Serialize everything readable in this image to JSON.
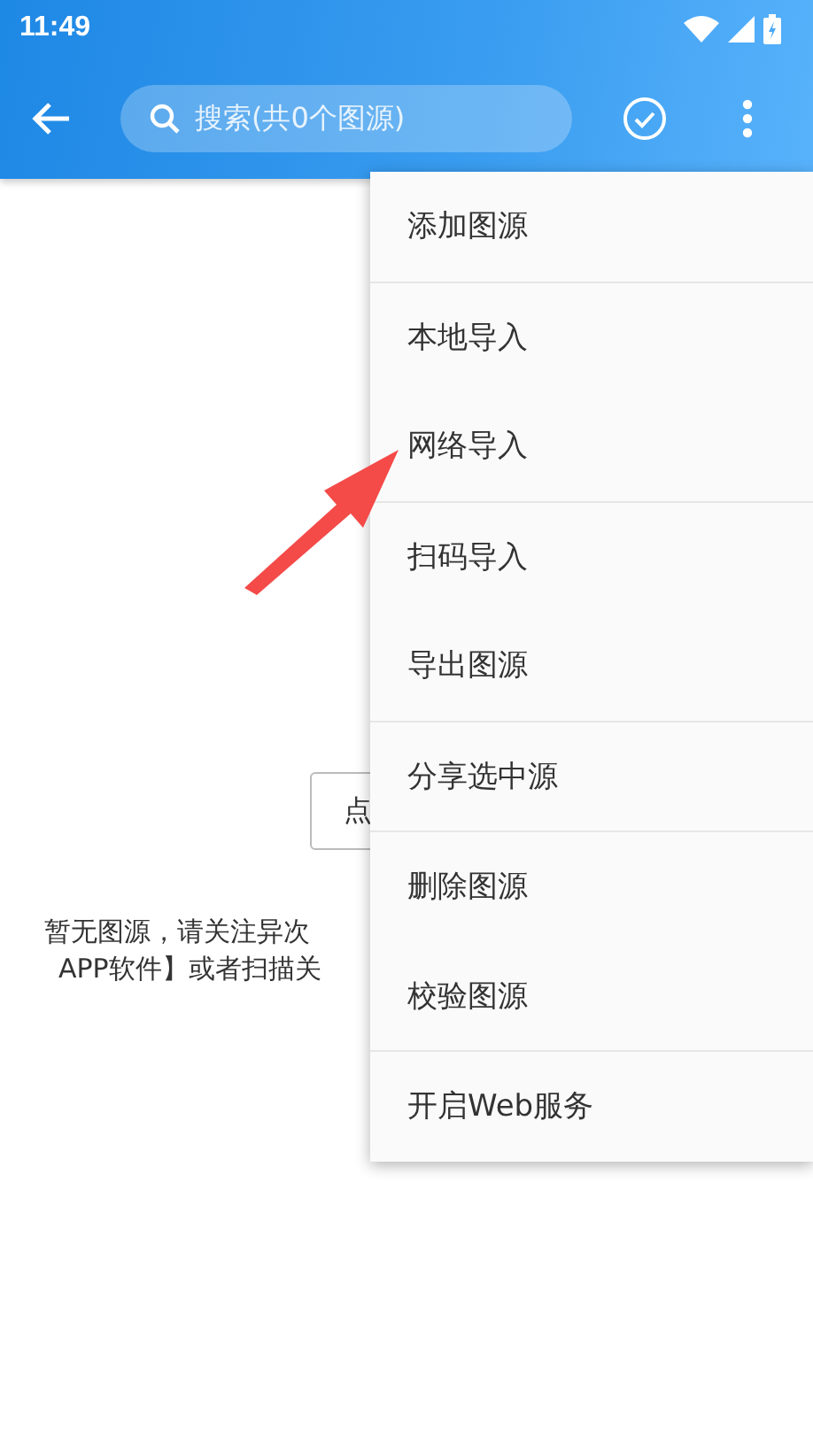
{
  "status_bar": {
    "time": "11:49"
  },
  "toolbar": {
    "search": {
      "placeholder": "搜索(共0个图源)"
    }
  },
  "content": {
    "button_label": "点",
    "message_lines": [
      "暂无图源，请关注异次",
      "APP软件】或者扫描关"
    ]
  },
  "menu": {
    "groups": [
      [
        "添加图源"
      ],
      [
        "本地导入",
        "网络导入"
      ],
      [
        "扫码导入",
        "导出图源"
      ],
      [
        "分享选中源"
      ],
      [
        "删除图源",
        "校验图源"
      ],
      [
        "开启Web服务"
      ]
    ]
  }
}
